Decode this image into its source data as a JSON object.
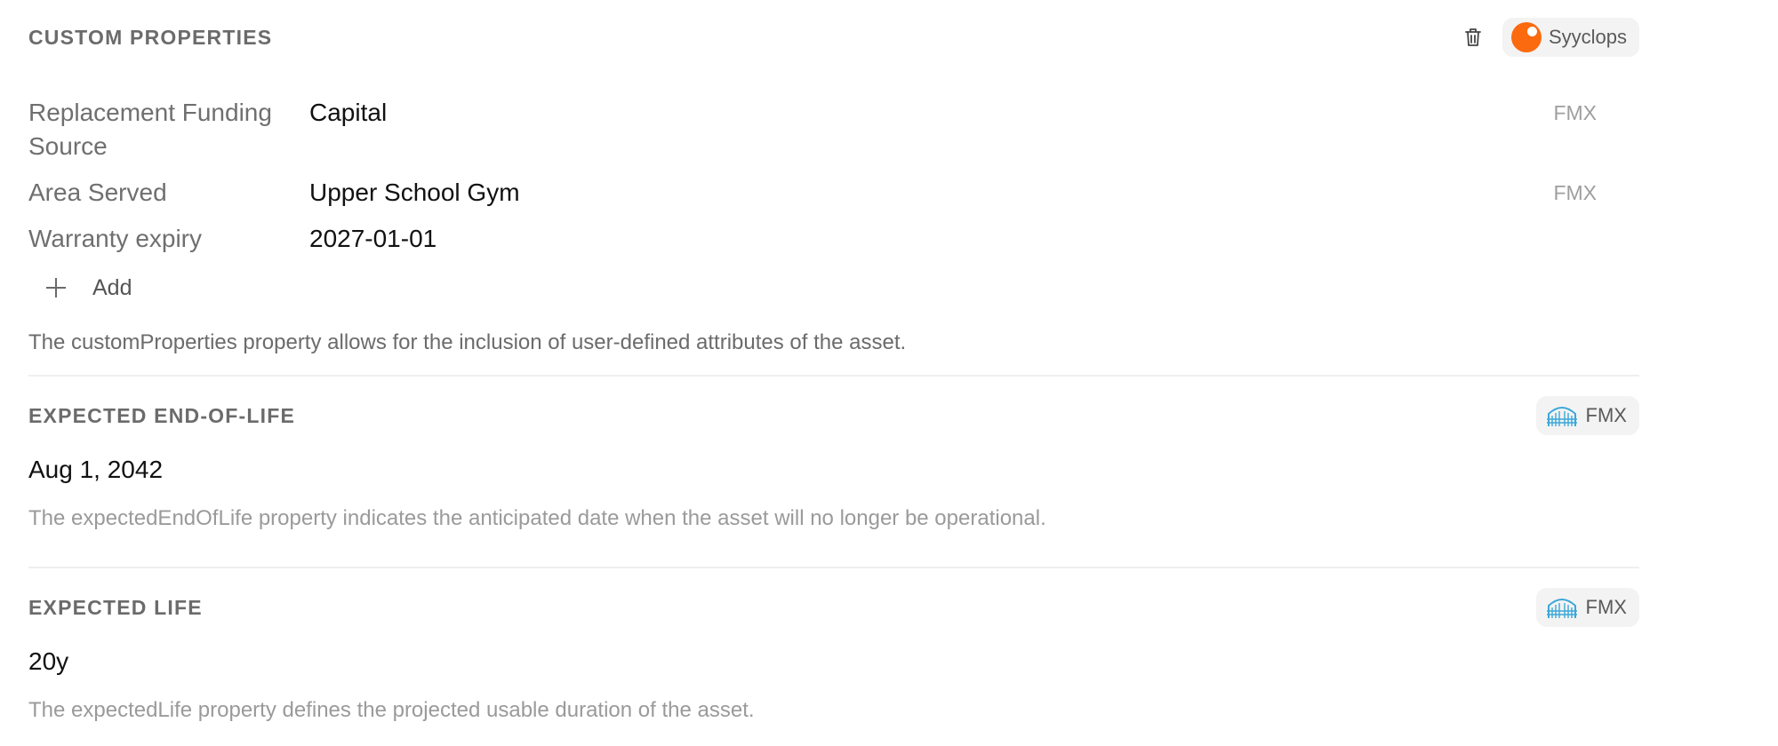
{
  "custom_properties": {
    "title": "CUSTOM PROPERTIES",
    "source_label": "Syyclops",
    "items": [
      {
        "key": "Replacement Funding Source",
        "value": "Capital",
        "source": "FMX"
      },
      {
        "key": "Area Served",
        "value": "Upper School Gym",
        "source": "FMX"
      },
      {
        "key": "Warranty expiry",
        "value": "2027-01-01",
        "source": ""
      }
    ],
    "add_label": "Add",
    "description": "The customProperties property allows for the inclusion of user-defined attributes of the asset."
  },
  "expected_end_of_life": {
    "title": "EXPECTED END-OF-LIFE",
    "source_label": "FMX",
    "value": "Aug 1, 2042",
    "description": "The expectedEndOfLife property indicates the anticipated date when the asset will no longer be operational."
  },
  "expected_life": {
    "title": "EXPECTED LIFE",
    "source_label": "FMX",
    "value": "20y",
    "description": "The expectedLife property defines the projected usable duration of the asset."
  },
  "colors": {
    "syyclops_accent": "#fb6a0f",
    "fmx_accent": "#3aa8d8"
  }
}
